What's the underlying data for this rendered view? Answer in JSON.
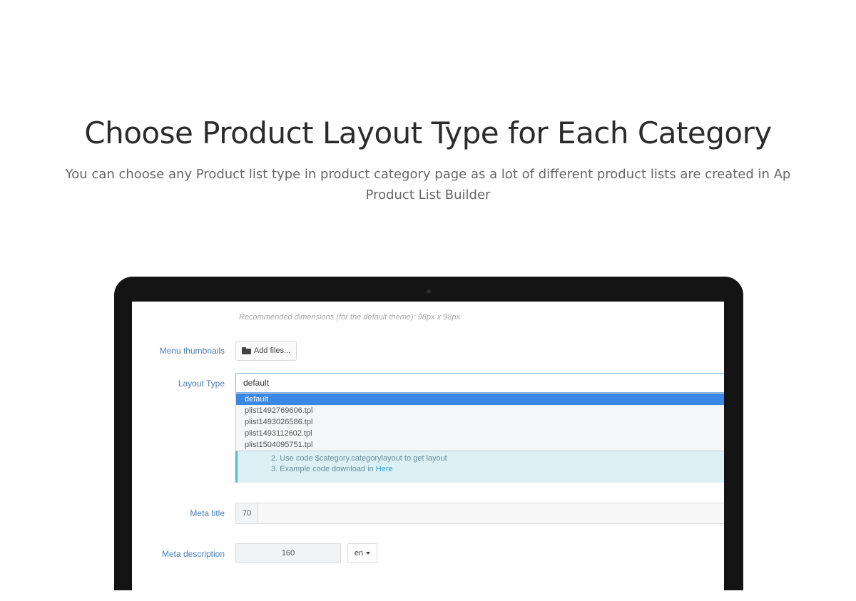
{
  "headline": "Choose Product Layout Type for Each Category",
  "subline": "You can choose any Product list type in product category page as a lot of different product lists are created in Ap Product List Builder",
  "form": {
    "hint": "Recommended dimensions (for the default theme): 98px x 98px",
    "menu_thumbnails_label": "Menu thumbnails",
    "add_files_label": "Add files...",
    "layout_type_label": "Layout Type",
    "layout_type_value": "default",
    "layout_options": [
      "default",
      "plist1492769606.tpl",
      "plist1493026586.tpl",
      "plist1493112602.tpl",
      "plist1504095751.tpl"
    ],
    "info_line2": "2. Use code $category.categorylayout to get layout",
    "info_line3_prefix": "3. Example code download in ",
    "info_line3_link": "Here",
    "meta_title_label": "Meta title",
    "meta_title_count": "70",
    "meta_description_label": "Meta description",
    "meta_description_count": "160",
    "language_value": "en"
  }
}
